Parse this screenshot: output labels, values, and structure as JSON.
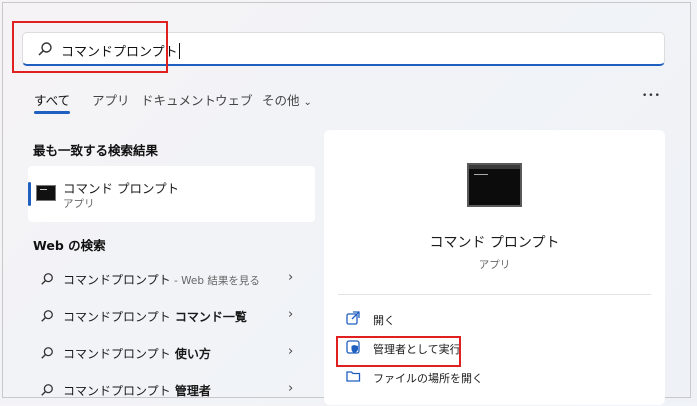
{
  "search": {
    "query": "コマンドプロンプト"
  },
  "tabs": [
    "すべて",
    "アプリ",
    "ドキュメント",
    "ウェブ",
    "その他"
  ],
  "more_label": "•••",
  "best_match": {
    "heading": "最も一致する検索結果",
    "title": "コマンド プロンプト",
    "type": "アプリ"
  },
  "web": {
    "heading": "Web の検索",
    "items": [
      {
        "main": "コマンドプロンプト",
        "suffix": " - Web 結果を見る",
        "bold": false
      },
      {
        "main": "コマンドプロンプト",
        "suffix": " コマンド一覧",
        "bold": true
      },
      {
        "main": "コマンドプロンプト",
        "suffix": " 使い方",
        "bold": true
      },
      {
        "main": "コマンドプロンプト",
        "suffix": " 管理者",
        "bold": true
      }
    ]
  },
  "detail": {
    "title": "コマンド プロンプト",
    "type": "アプリ",
    "actions": [
      {
        "label": "開く",
        "icon": "open-icon"
      },
      {
        "label": "管理者として実行",
        "icon": "shield-icon"
      },
      {
        "label": "ファイルの場所を開く",
        "icon": "folder-icon"
      }
    ]
  },
  "colors": {
    "accent": "#1f5fbf",
    "highlight": "#e02020"
  }
}
